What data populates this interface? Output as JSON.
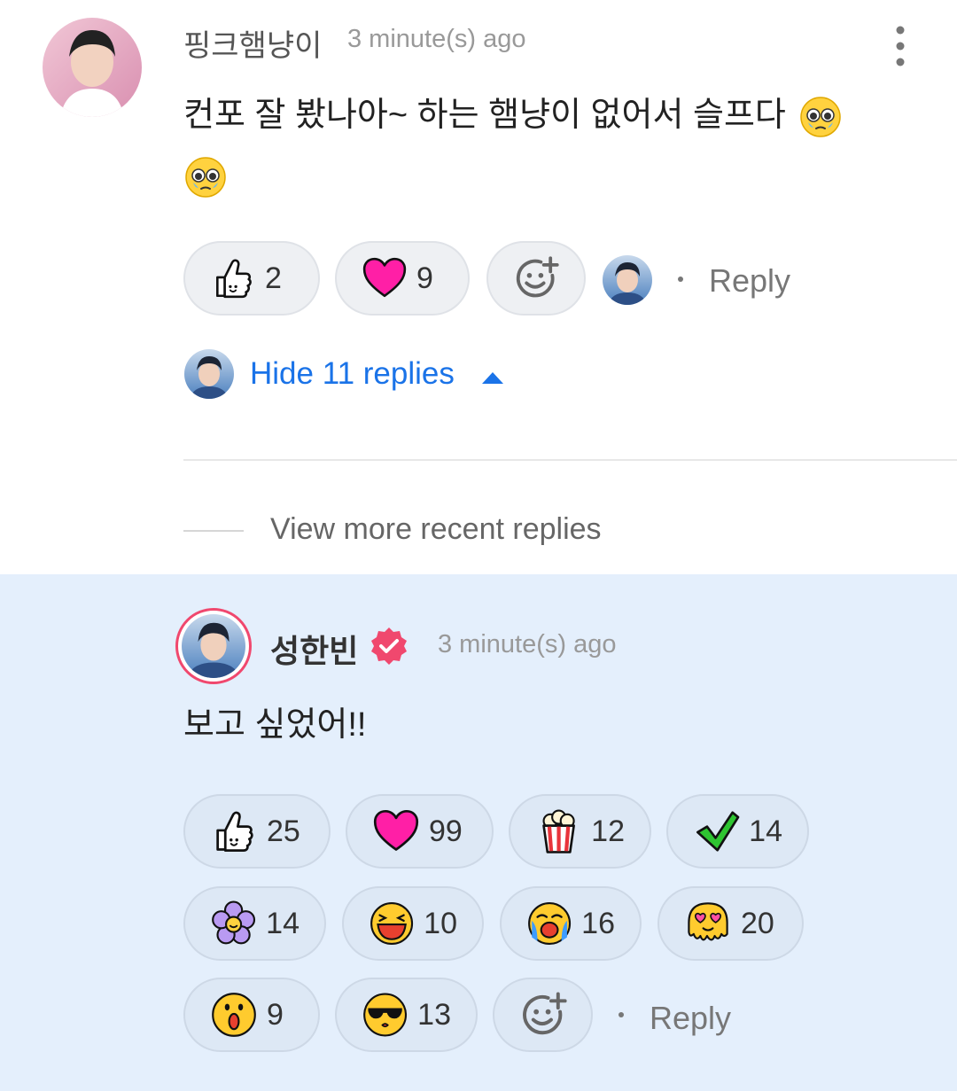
{
  "comment": {
    "author": "핑크햄냥이",
    "time": "3 minute(s) ago",
    "text_line1": "컨포 잘 봤나아~ 하는 햄냥이 없어서 슬프다",
    "reactions": [
      {
        "icon": "thumbs-up-icon",
        "count": "2"
      },
      {
        "icon": "heart-icon",
        "count": "9"
      }
    ],
    "reply_label": "Reply",
    "hide_replies_label": "Hide 11 replies"
  },
  "replies_nav": {
    "view_more_label": "View more recent replies"
  },
  "reply": {
    "author": "성한빈",
    "time": "3 minute(s) ago",
    "text": "보고 싶었어!!",
    "reply_label": "Reply",
    "reactions": [
      {
        "icon": "thumbs-up-icon",
        "count": "25"
      },
      {
        "icon": "heart-icon",
        "count": "99"
      },
      {
        "icon": "popcorn-icon",
        "count": "12"
      },
      {
        "icon": "checkmark-icon",
        "count": "14"
      },
      {
        "icon": "flower-icon",
        "count": "14"
      },
      {
        "icon": "laughing-face-icon",
        "count": "10"
      },
      {
        "icon": "crying-face-icon",
        "count": "16"
      },
      {
        "icon": "heart-eyes-melting-face-icon",
        "count": "20"
      },
      {
        "icon": "surprised-face-icon",
        "count": "9"
      },
      {
        "icon": "sunglasses-face-icon",
        "count": "13"
      }
    ]
  },
  "colors": {
    "link_blue": "#1a73e8",
    "reply_bg": "#e4effc",
    "verified_pink": "#f0486e",
    "heart_pink": "#ff1fa6"
  }
}
